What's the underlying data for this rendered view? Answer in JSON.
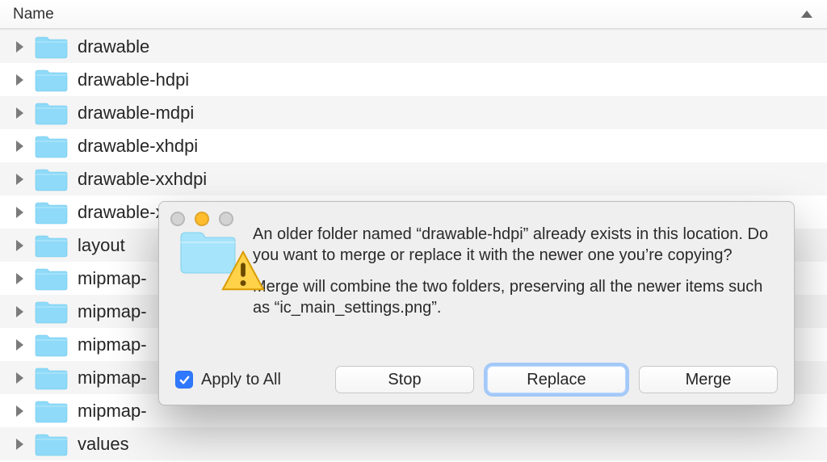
{
  "header": {
    "column_label": "Name"
  },
  "rows": [
    "drawable",
    "drawable-hdpi",
    "drawable-mdpi",
    "drawable-xhdpi",
    "drawable-xxhdpi",
    "drawable-xxxhdpi",
    "layout",
    "mipmap-",
    "mipmap-",
    "mipmap-",
    "mipmap-",
    "mipmap-",
    "values"
  ],
  "dialog": {
    "para1": "An older folder named “drawable-hdpi” already exists in this location. Do you want to merge or replace it with the newer one you’re copying?",
    "para2": "Merge will combine the two folders, preserving all the newer items such as “ic_main_settings.png”.",
    "apply_label": "Apply to All",
    "apply_checked": true,
    "buttons": {
      "stop": "Stop",
      "replace": "Replace",
      "merge": "Merge"
    }
  },
  "colors": {
    "folder": "#8fdaf8",
    "accent": "#2f78ff"
  }
}
